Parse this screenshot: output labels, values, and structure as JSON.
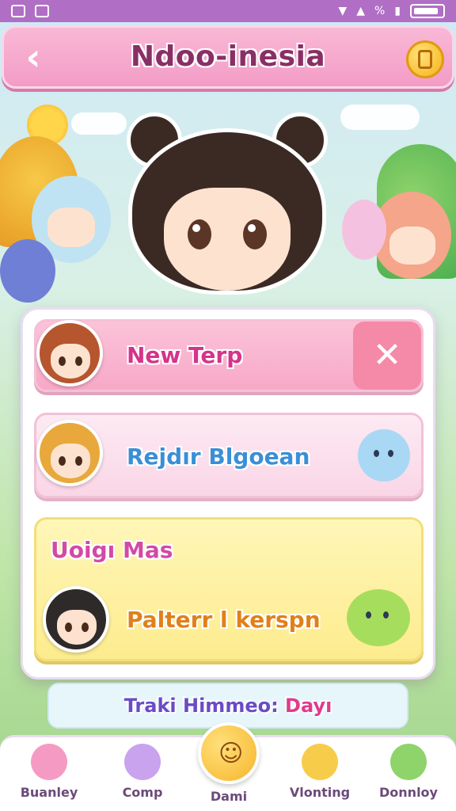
{
  "status_bar": {
    "icons": [
      "home-icon",
      "gallery-icon",
      "wifi-icon",
      "signal-icon",
      "data-icon",
      "battery-icon"
    ]
  },
  "header": {
    "title": "Ndoo-inesia",
    "back_icon": "chevron-left-icon",
    "action_icon": "coin-icon"
  },
  "menu": {
    "items": [
      {
        "label": "New Terp",
        "action_icon": "close-icon"
      },
      {
        "label": "Rejdır Blgoean",
        "mascot": "blue-bunny-mascot"
      },
      {
        "subtitle": "Uoigı Mas",
        "label": "Palterr l kerspn",
        "mascot": "green-bunny-mascot"
      }
    ]
  },
  "ticker": {
    "part1": "Traki Himmeo:",
    "part2": "Dayı"
  },
  "bottom_nav": {
    "items": [
      {
        "label": "Buanley",
        "icon": "pink-blob-icon"
      },
      {
        "label": "Comp",
        "icon": "heart-bag-icon"
      },
      {
        "label": "Dami",
        "icon": "smiley-icon"
      },
      {
        "label": "Vlonting",
        "icon": "yellow-heart-icon"
      },
      {
        "label": "Donnloy",
        "icon": "green-cloud-icon"
      }
    ]
  },
  "colors": {
    "header": "#f39cc6",
    "status_bar": "#b06fc4",
    "accent_pink": "#d6338a",
    "accent_blue": "#3a8fd6",
    "accent_orange": "#e0801b"
  }
}
